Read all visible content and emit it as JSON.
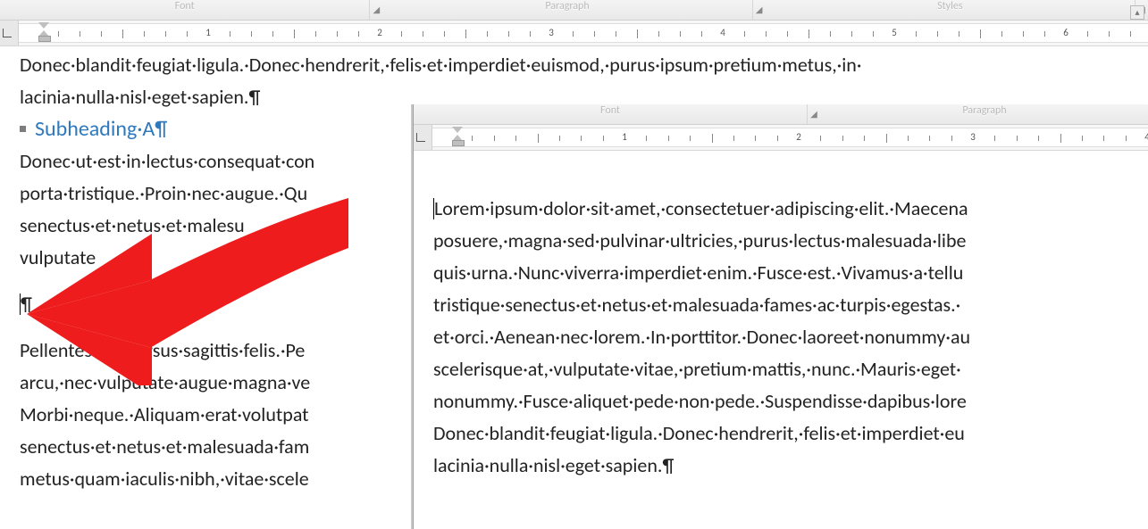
{
  "backWindow": {
    "ribbon": {
      "groups": [
        "Font",
        "Paragraph",
        "Styles"
      ]
    },
    "ruler": {
      "numbers": [
        "1",
        "2",
        "3",
        "4",
        "5",
        "6"
      ],
      "inchPx": 192,
      "startPx": 20
    },
    "doc": {
      "line1": "Donec·blandit·feugiat·ligula.·Donec·hendrerit,·felis·et·imperdiet·euismod,·purus·ipsum·pretium·metus,·in·",
      "line2": "lacinia·nulla·nisl·eget·sapien.¶",
      "subheading": "Subheading·A¶",
      "p2l1": "Donec·ut·est·in·lectus·consequat·con",
      "p2l2": "porta·tristique.·Proin·nec·augue.·Qu",
      "p2l3": "senectus·et·netus·et·malesu",
      "p2l4": "vulputate",
      "empty": "¶",
      "p3l1": "Pellentesque·cursus·sagittis·felis.·Pe",
      "p3l2": "arcu,·nec·vulputate·augue·magna·ve",
      "p3l3": "Morbi·neque.·Aliquam·erat·volutpat",
      "p3l4": "senectus·et·netus·et·malesuada·fam",
      "p3l5": "metus·quam·iaculis·nibh,·vitae·scele"
    }
  },
  "frontWindow": {
    "ribbon": {
      "groups": [
        "Font",
        "Paragraph"
      ]
    },
    "ruler": {
      "numbers": [
        "1",
        "2",
        "3",
        "4"
      ],
      "inchPx": 195,
      "startPx": 20
    },
    "doc": {
      "l1": "Lorem·ipsum·dolor·sit·amet,·consectetuer·adipiscing·elit.·Maecena",
      "l2": "posuere,·magna·sed·pulvinar·ultricies,·purus·lectus·malesuada·libe",
      "l3": "quis·urna.·Nunc·viverra·imperdiet·enim.·Fusce·est.·Vivamus·a·tellu",
      "l4": "tristique·senectus·et·netus·et·malesuada·fames·ac·turpis·egestas.·",
      "l5": "et·orci.·Aenean·nec·lorem.·In·porttitor.·Donec·laoreet·nonummy·au",
      "l6": "scelerisque·at,·vulputate·vitae,·pretium·mattis,·nunc.·Mauris·eget·",
      "l7": "nonummy.·Fusce·aliquet·pede·non·pede.·Suspendisse·dapibus·lore",
      "l8": "Donec·blandit·feugiat·ligula.·Donec·hendrerit,·felis·et·imperdiet·eu",
      "l9": "lacinia·nulla·nisl·eget·sapien.¶"
    }
  }
}
